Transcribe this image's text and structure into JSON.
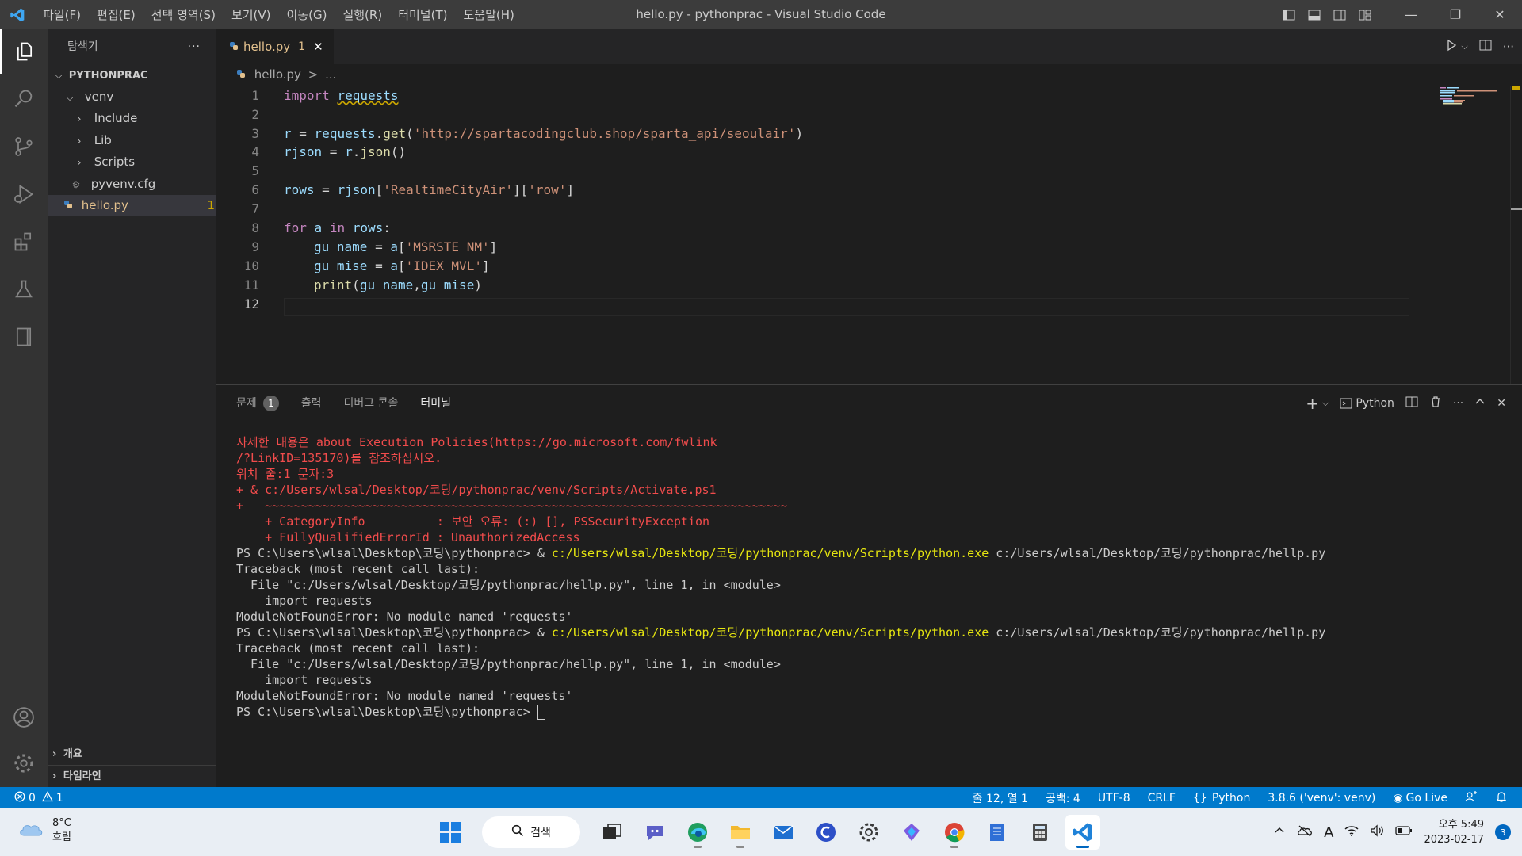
{
  "titlebar": {
    "menus": [
      "파일(F)",
      "편집(E)",
      "선택 영역(S)",
      "보기(V)",
      "이동(G)",
      "실행(R)",
      "터미널(T)",
      "도움말(H)"
    ],
    "window_title": "hello.py - pythonprac - Visual Studio Code"
  },
  "sidebar": {
    "title": "탐색기",
    "more": "···",
    "project": "PYTHONPRAC",
    "tree": [
      {
        "label": "venv",
        "kind": "folder-open",
        "depth": 1
      },
      {
        "label": "Include",
        "kind": "folder",
        "depth": 2
      },
      {
        "label": "Lib",
        "kind": "folder",
        "depth": 2
      },
      {
        "label": "Scripts",
        "kind": "folder",
        "depth": 2
      },
      {
        "label": "pyvenv.cfg",
        "kind": "config-file",
        "depth": 2
      },
      {
        "label": "hello.py",
        "kind": "python-file",
        "depth": 1,
        "badge": "1",
        "selected": true
      }
    ],
    "outline": "개요",
    "timeline": "타임라인"
  },
  "editor": {
    "tab": {
      "label": "hello.py",
      "problems": "1"
    },
    "breadcrumb": {
      "file": "hello.py",
      "sep": ">",
      "rest": "..."
    },
    "line_numbers": [
      "1",
      "2",
      "3",
      "4",
      "5",
      "6",
      "7",
      "8",
      "9",
      "10",
      "11",
      "12"
    ],
    "code": {
      "l1_kw": "import",
      "l1_mod": "requests",
      "l3_a": "r",
      "l3_b": " = ",
      "l3_c": "requests",
      "l3_d": ".",
      "l3_e": "get",
      "l3_f": "(",
      "l3_q1": "'",
      "l3_url": "http://spartacodingclub.shop/sparta_api/seoulair",
      "l3_q2": "'",
      "l3_g": ")",
      "l4_a": "rjson",
      "l4_b": " = ",
      "l4_c": "r",
      "l4_d": ".",
      "l4_e": "json",
      "l4_f": "()",
      "l6_a": "rows",
      "l6_b": " = ",
      "l6_c": "rjson",
      "l6_d": "[",
      "l6_e": "'RealtimeCityAir'",
      "l6_f": "][",
      "l6_g": "'row'",
      "l6_h": "]",
      "l8_a": "for",
      "l8_b": " a ",
      "l8_c": "in",
      "l8_d": " rows",
      "l8_e": ":",
      "l9_a": "gu_name",
      "l9_b": " = ",
      "l9_c": "a",
      "l9_d": "[",
      "l9_e": "'MSRSTE_NM'",
      "l9_f": "]",
      "l10_a": "gu_mise",
      "l10_b": " = ",
      "l10_c": "a",
      "l10_d": "[",
      "l10_e": "'IDEX_MVL'",
      "l10_f": "]",
      "l11_a": "print",
      "l11_b": "(",
      "l11_c": "gu_name",
      "l11_d": ",",
      "l11_e": "gu_mise",
      "l11_f": ")"
    }
  },
  "panel": {
    "tabs": {
      "problems": "문제",
      "problems_count": "1",
      "output": "출력",
      "debug_console": "디버그 콘솔",
      "terminal": "터미널"
    },
    "shell": "Python",
    "terminal_lines": {
      "e1": "자세한 내용은 about_Execution_Policies(https://go.microsoft.com/fwlink",
      "e2": "/?LinkID=135170)를 참조하십시오.",
      "e3": "위치 줄:1 문자:3",
      "e4": "+ & c:/Users/wlsal/Desktop/코딩/pythonprac/venv/Scripts/Activate.ps1",
      "e5": "+   ~~~~~~~~~~~~~~~~~~~~~~~~~~~~~~~~~~~~~~~~~~~~~~~~~~~~~~~~~~~~~~~~~~~~~~~~~",
      "e6": "    + CategoryInfo          : 보안 오류: (:) [], PSSecurityException",
      "e7": "    + FullyQualifiedErrorId : UnauthorizedAccess",
      "p1": "PS C:\\Users\\wlsal\\Desktop\\코딩\\pythonprac> ",
      "amp": "& ",
      "exe": "c:/Users/wlsal/Desktop/코딩/pythonprac/venv/Scripts/python.exe",
      "script": " c:/Users/wlsal/Desktop/코딩/pythonprac/hellp.py",
      "tb1": "Traceback (most recent call last):",
      "tb2": "  File \"c:/Users/wlsal/Desktop/코딩/pythonprac/hellp.py\", line 1, in <module>",
      "tb3": "    import requests",
      "tb4": "ModuleNotFoundError: No module named 'requests'"
    }
  },
  "statusbar": {
    "errors": "0",
    "warnings": "1",
    "position": "줄 12, 열 1",
    "spaces": "공백: 4",
    "encoding": "UTF-8",
    "eol": "CRLF",
    "language": "Python",
    "interpreter": "3.8.6 ('venv': venv)",
    "golive": "Go Live"
  },
  "taskbar": {
    "temperature": "8°C",
    "weather": "흐림",
    "search": "검색",
    "time": "오후 5:49",
    "date": "2023-02-17",
    "notifications": "3"
  }
}
